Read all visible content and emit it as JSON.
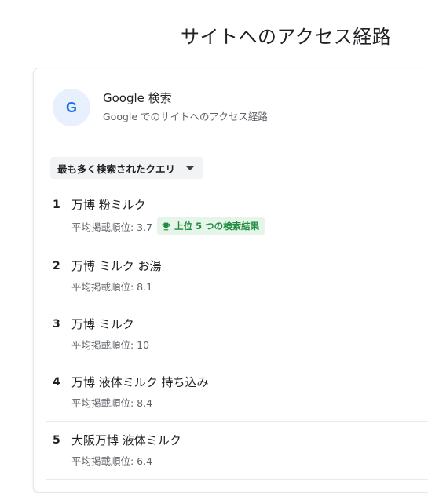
{
  "page": {
    "title": "サイトへのアクセス経路"
  },
  "source": {
    "name": "Google 検索",
    "description": "Google でのサイトへのアクセス経路",
    "icon": "google-g-icon"
  },
  "query_filter": {
    "selected": "最も多く検索されたクエリ"
  },
  "queries": [
    {
      "rank": "1",
      "text": "万博 粉ミルク",
      "avg_position": "平均掲載順位: 3.7",
      "badge": "上位 5 つの検索結果"
    },
    {
      "rank": "2",
      "text": "万博 ミルク お湯",
      "avg_position": "平均掲載順位: 8.1"
    },
    {
      "rank": "3",
      "text": "万博 ミルク",
      "avg_position": "平均掲載順位: 10"
    },
    {
      "rank": "4",
      "text": "万博 液体ミルク 持ち込み",
      "avg_position": "平均掲載順位: 8.4"
    },
    {
      "rank": "5",
      "text": "大阪万博 液体ミルク",
      "avg_position": "平均掲載順位: 6.4"
    }
  ],
  "colors": {
    "google_blue": "#1a73e8",
    "badge_green": "#1e8e3e",
    "badge_bg": "#e6f4ea"
  }
}
